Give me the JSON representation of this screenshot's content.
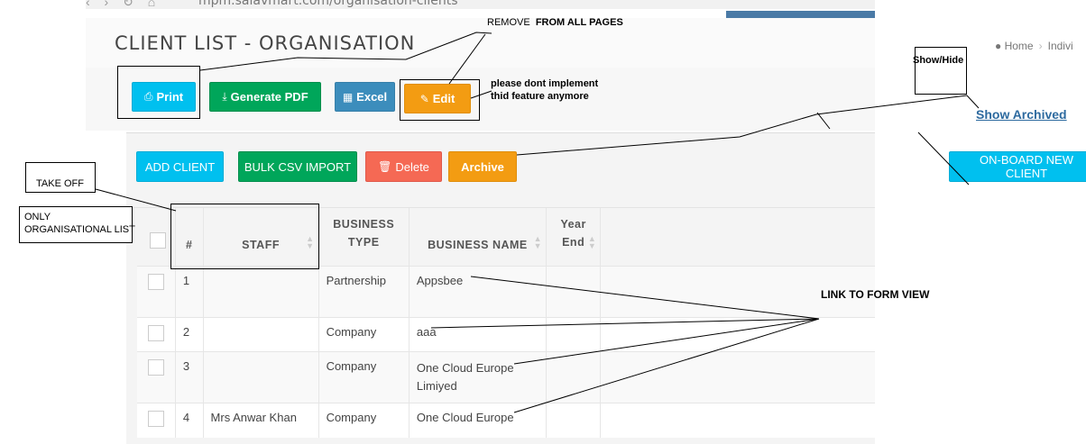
{
  "browser": {
    "nav_glyphs": "‹ › ↻ ⌂",
    "url": "mpm.salavmart.com/organisation-clients"
  },
  "header": {
    "title": "CLIENT LIST - ORGANISATION",
    "breadcrumb": {
      "home": "Home",
      "current": "Indivi"
    }
  },
  "toolbar": {
    "print": "Print",
    "pdf": "Generate PDF",
    "excel": "Excel",
    "edit": "Edit"
  },
  "actions": {
    "add_client": "ADD CLIENT",
    "bulk_import": "BULK CSV IMPORT",
    "delete": "Delete",
    "archive": "Archive",
    "onboard": "ON-BOARD NEW CLIENT",
    "show_archived": "Show Archived"
  },
  "table": {
    "headers": {
      "num": "#",
      "staff": "STAFF",
      "business_type_1": "BUSINESS",
      "business_type_2": "TYPE",
      "business_name": "BUSINESS NAME",
      "year_end_1": "Year",
      "year_end_2": "End"
    },
    "rows": [
      {
        "num": "1",
        "staff": "",
        "type": "Partnership",
        "name": "Appsbee",
        "year_end": ""
      },
      {
        "num": "2",
        "staff": "",
        "type": "Company",
        "name": "aaa",
        "year_end": ""
      },
      {
        "num": "3",
        "staff": "",
        "type": "Company",
        "name": "One Cloud Europe Limiyed",
        "year_end": ""
      },
      {
        "num": "4",
        "staff": "Mrs Anwar Khan",
        "type": "Company",
        "name": "One Cloud Europe",
        "year_end": ""
      }
    ]
  },
  "annotations": {
    "remove": "REMOVE",
    "from_all_pages": "FROM ALL PAGES",
    "dont_implement_1": "please dont implement",
    "dont_implement_2": "thid feature anymore",
    "show_hide": "Show/Hide",
    "take_off": "TAKE OFF",
    "only_org_1": "ONLY",
    "only_org_2": "ORGANISATIONAL LIST",
    "link_form": "LINK TO FORM VIEW"
  },
  "colors": {
    "cyan": "#00c0ef",
    "green": "#00a65a",
    "blue": "#3c8dbc",
    "orange": "#f39c12",
    "red": "#f56954",
    "link": "#2d6a9f"
  }
}
